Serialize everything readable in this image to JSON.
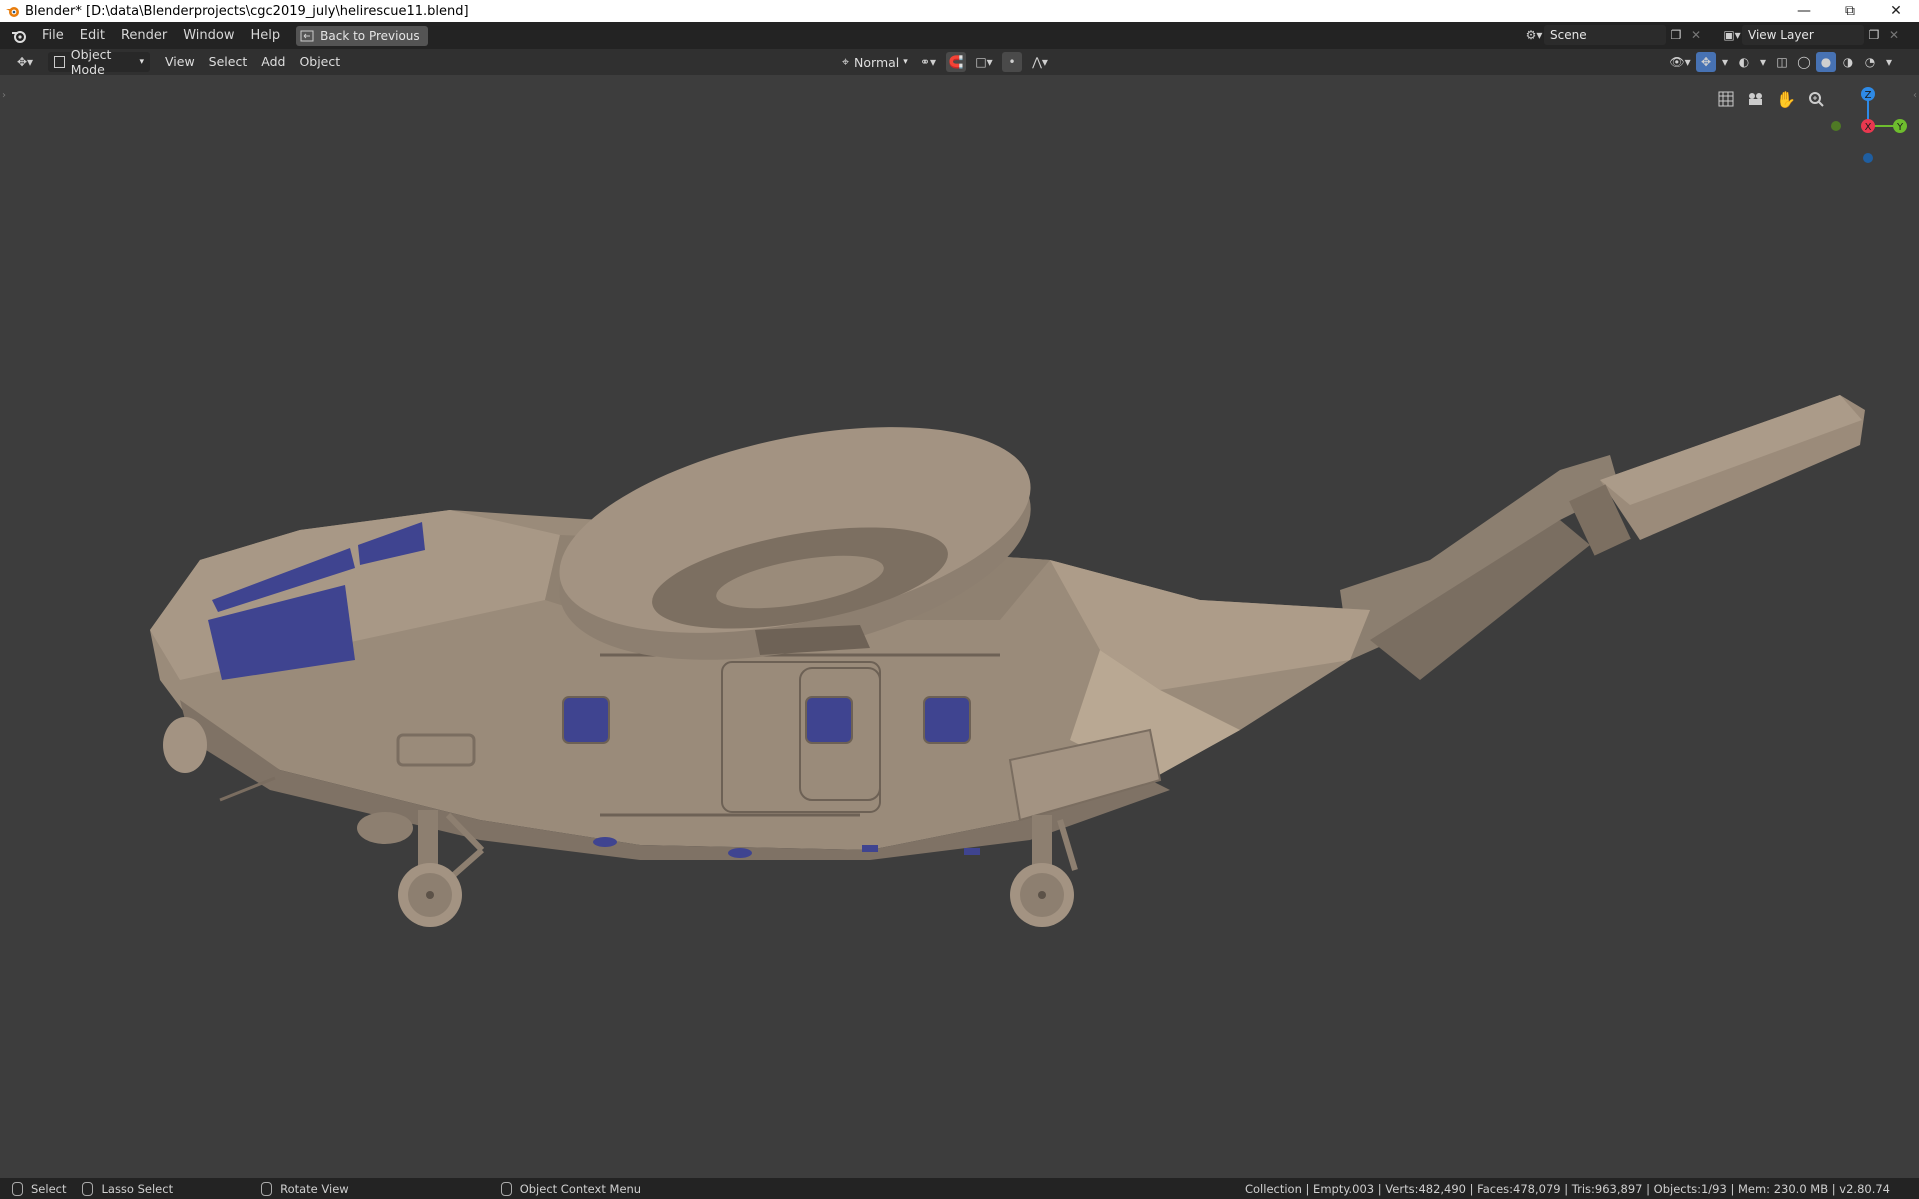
{
  "window": {
    "title": "Blender* [D:\\data\\Blenderprojects\\cgc2019_july\\helirescue11.blend]",
    "controls": [
      "minimize",
      "restore",
      "close"
    ]
  },
  "topbar": {
    "menus": [
      "File",
      "Edit",
      "Render",
      "Window",
      "Help"
    ],
    "back_button": "Back to Previous",
    "scene_name": "Scene",
    "view_layer": "View Layer"
  },
  "header3d": {
    "mode": "Object Mode",
    "menus": [
      "View",
      "Select",
      "Add",
      "Object"
    ],
    "transform_orientation": "Normal"
  },
  "gizmo": {
    "z": "Z",
    "x": "X",
    "y": "Y"
  },
  "statusbar": {
    "select": "Select",
    "lasso": "Lasso Select",
    "rotate": "Rotate View",
    "context_menu": "Object Context Menu",
    "stats": "Collection | Empty.003 | Verts:482,490 | Faces:478,079 | Tris:963,897 | Objects:1/93 | Mem: 230.0 MB | v2.80.74"
  },
  "colors": {
    "viewport_bg": "#3d3d3d",
    "model_body": "#9a8b7a",
    "window_glass": "#3f4490",
    "accent_blue": "#4772b3",
    "axis_x": "#e8384f",
    "axis_y": "#6ebd2e",
    "axis_z": "#2e8ae6"
  }
}
